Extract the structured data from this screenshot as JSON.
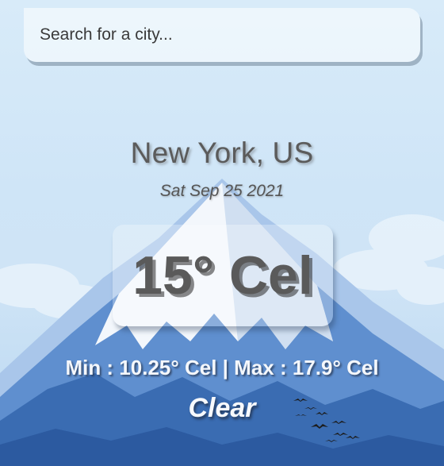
{
  "search": {
    "placeholder": "Search for a city...",
    "value": ""
  },
  "location": {
    "city": "New York, US",
    "date": "Sat Sep 25 2021"
  },
  "weather": {
    "temperature": "15° Cel",
    "min_max": "Min : 10.25° Cel | Max : 17.9° Cel",
    "condition": "Clear"
  },
  "colors": {
    "sky": "#cfe5f7",
    "mountain": "#4a78b8",
    "snow": "#eef4fb",
    "text_dark": "#5a5a5a",
    "text_light": "#f4f7fb"
  }
}
